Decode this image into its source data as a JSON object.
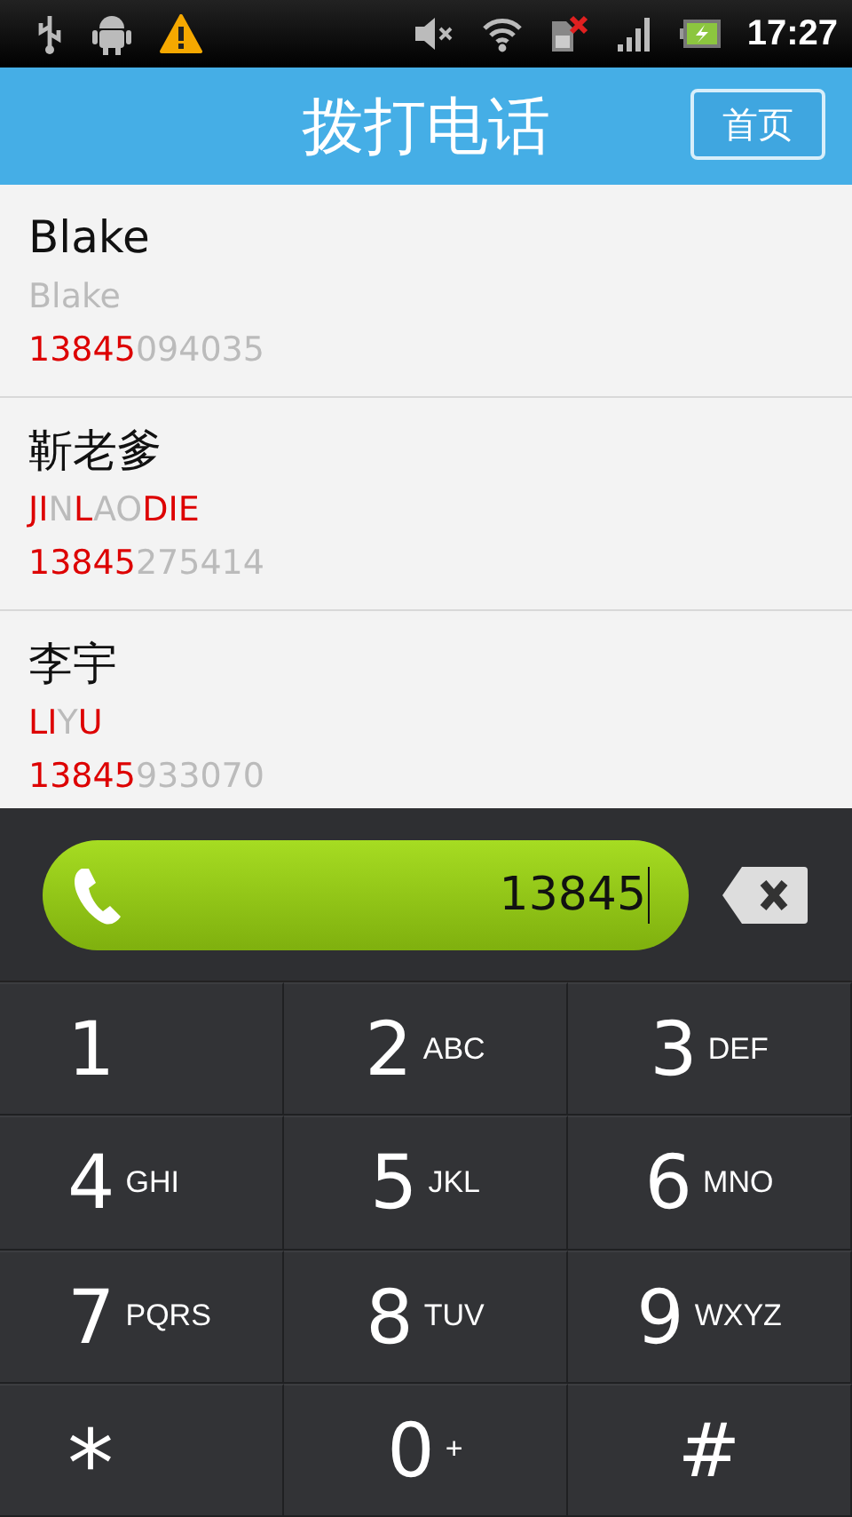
{
  "status_bar": {
    "time": "17:27"
  },
  "header": {
    "title": "拨打电话",
    "home_button": "首页"
  },
  "contacts": [
    {
      "name": "Blake",
      "pinyin": [
        {
          "text": "Blake",
          "match": false
        }
      ],
      "phone": [
        {
          "text": "13845",
          "match": true
        },
        {
          "text": "094035",
          "match": false
        }
      ]
    },
    {
      "name": "靳老爹",
      "pinyin": [
        {
          "text": "JI",
          "match": true
        },
        {
          "text": "N",
          "match": false
        },
        {
          "text": "L",
          "match": true
        },
        {
          "text": "AO",
          "match": false
        },
        {
          "text": "DIE",
          "match": true
        }
      ],
      "phone": [
        {
          "text": "13845",
          "match": true
        },
        {
          "text": "275414",
          "match": false
        }
      ]
    },
    {
      "name": "李宇",
      "pinyin": [
        {
          "text": "LI",
          "match": true
        },
        {
          "text": "Y",
          "match": false
        },
        {
          "text": "U",
          "match": true
        }
      ],
      "phone": [
        {
          "text": "13845",
          "match": true
        },
        {
          "text": "933070",
          "match": false
        }
      ]
    }
  ],
  "dial_field": {
    "value": "13845"
  },
  "keys": [
    {
      "digit": "1"
    },
    {
      "digit": "2",
      "letters": "ABC"
    },
    {
      "digit": "3",
      "letters": "DEF"
    },
    {
      "digit": "4",
      "letters": "GHI"
    },
    {
      "digit": "5",
      "letters": "JKL"
    },
    {
      "digit": "6",
      "letters": "MNO"
    },
    {
      "digit": "7",
      "letters": "PQRS"
    },
    {
      "digit": "8",
      "letters": "TUV"
    },
    {
      "digit": "9",
      "letters": "WXYZ"
    },
    {
      "digit": "*"
    },
    {
      "digit": "0",
      "letters": "+"
    },
    {
      "digit": "#"
    }
  ]
}
